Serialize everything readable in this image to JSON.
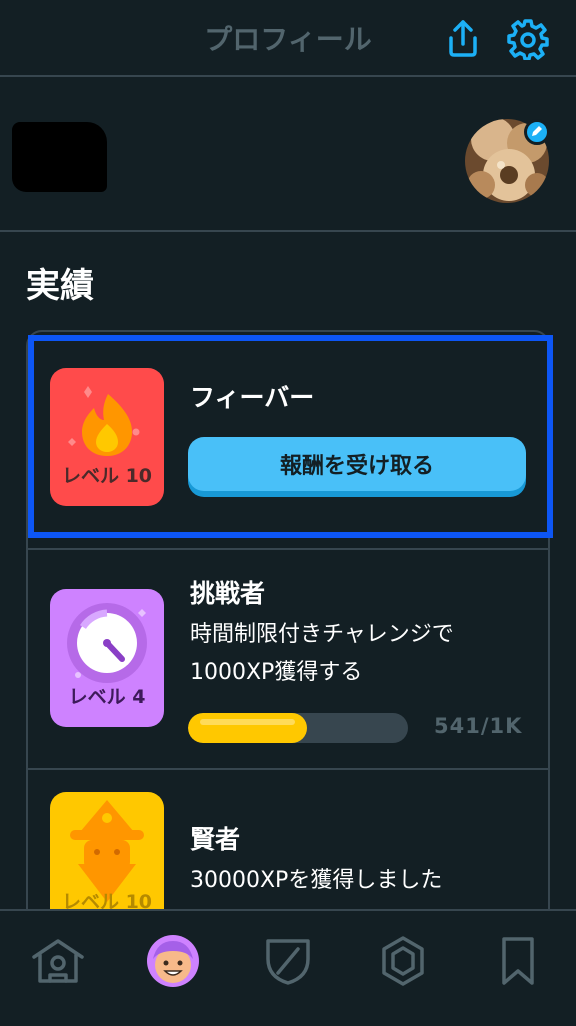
{
  "header": {
    "title": "プロフィール",
    "share_icon": "share-icon",
    "settings_icon": "gear-icon"
  },
  "profile": {
    "avatar_icon": "profile-photo",
    "edit_icon": "pencil-icon"
  },
  "achievements": {
    "section_title": "実績",
    "items": [
      {
        "title": "フィーバー",
        "badge_level": "レベル 10",
        "badge_icon": "flame-icon",
        "badge_color": "#ff4b4b",
        "button_label": "報酬を受け取る"
      },
      {
        "title": "挑戦者",
        "description_line1": "時間制限付きチャレンジで",
        "description_line2": "1000XP獲得する",
        "badge_level": "レベル 4",
        "badge_icon": "stopwatch-icon",
        "badge_color": "#ce82ff",
        "progress_text": "541/1K",
        "progress_value": 0.541
      },
      {
        "title": "賢者",
        "description": "30000XPを獲得しました",
        "badge_level": "レベル 10",
        "badge_icon": "wizard-icon",
        "badge_color": "#ffc800"
      }
    ]
  },
  "bottom_nav": {
    "items": [
      {
        "icon": "home-icon"
      },
      {
        "icon": "profile-avatar-icon",
        "active": true
      },
      {
        "icon": "shield-icon"
      },
      {
        "icon": "hexagon-icon"
      },
      {
        "icon": "bookmark-icon"
      }
    ]
  },
  "colors": {
    "background": "#131f24",
    "border": "#37464f",
    "accent_blue": "#1cb0f6",
    "highlight": "#0d56f5",
    "progress": "#ffc800"
  }
}
